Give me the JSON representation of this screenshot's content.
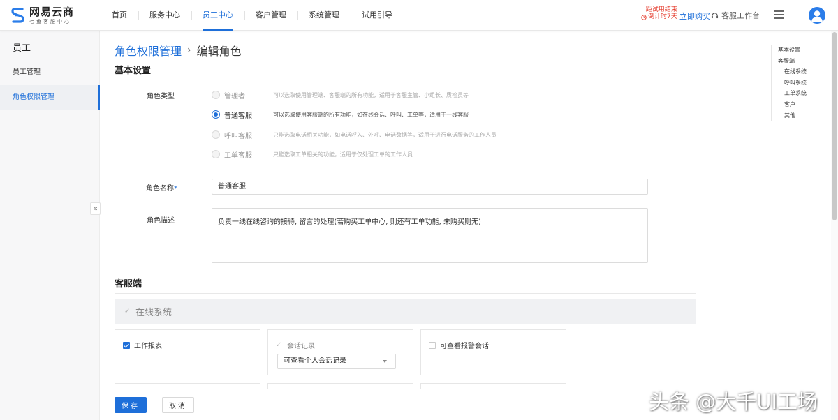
{
  "brand": {
    "name": "网易云商",
    "tagline": "七鱼客服中心"
  },
  "nav": {
    "items": [
      {
        "label": "首页",
        "active": false
      },
      {
        "label": "服务中心",
        "active": false
      },
      {
        "label": "员工中心",
        "active": true
      },
      {
        "label": "客户管理",
        "active": false
      },
      {
        "label": "系统管理",
        "active": false
      },
      {
        "label": "试用引导",
        "active": false
      }
    ],
    "trial_line1": "距试用结束",
    "trial_line2": "倒计时7天",
    "buy_label": "立即购买",
    "workbench_label": "客服工作台",
    "accent": "#1e6fd9",
    "trial_color": "#e53b2c"
  },
  "sidebar": {
    "title": "员工",
    "items": [
      {
        "label": "员工管理",
        "active": false
      },
      {
        "label": "角色权限管理",
        "active": true
      }
    ],
    "collapse_glyph": "«"
  },
  "breadcrumb": {
    "parent": "角色权限管理",
    "sep": "›",
    "current": "编辑角色"
  },
  "basic": {
    "title": "基本设置",
    "role_type_label": "角色类型",
    "role_types": [
      {
        "label": "管理者",
        "desc": "可以选取使用管理端、客服端的所有功能，适用于客服主管、小组长、质检员等",
        "selected": false
      },
      {
        "label": "普通客服",
        "desc": "可以选取使用客服端的所有功能，如在线会话、呼叫、工单等，适用于一线客服",
        "selected": true
      },
      {
        "label": "呼叫客服",
        "desc": "只能选取电话相关功能，如电话呼入、外呼、电话数据等，适用于进行电话服务的工作人员",
        "selected": false
      },
      {
        "label": "工单客服",
        "desc": "只能选取工单相关的功能，适用于仅处理工单的工作人员",
        "selected": false
      }
    ],
    "role_name_label": "角色名称",
    "required_mark": "*",
    "role_name_value": "普通客服",
    "role_desc_label": "角色描述",
    "role_desc_value": "负责一线在线咨询的接待, 留言的处理(若购买工单中心, 则还有工单功能, 未购买则无)"
  },
  "client": {
    "title": "客服端",
    "group_title": "在线系统",
    "cards": [
      {
        "label": "工作报表",
        "state": "checked"
      },
      {
        "label": "会话记录",
        "state": "disabled-checked",
        "select_value": "可查看个人会话记录"
      },
      {
        "label": "可查看报警会话",
        "state": "unchecked"
      }
    ]
  },
  "anchor": {
    "items": [
      {
        "label": "基本设置",
        "sub": false
      },
      {
        "label": "客服端",
        "sub": false
      },
      {
        "label": "在线系统",
        "sub": true
      },
      {
        "label": "呼叫系统",
        "sub": true
      },
      {
        "label": "工单系统",
        "sub": true
      },
      {
        "label": "客户",
        "sub": true
      },
      {
        "label": "其他",
        "sub": true
      }
    ]
  },
  "footer": {
    "save_label": "保存",
    "cancel_label": "取消"
  },
  "watermark": "头条 @大千UI工场"
}
